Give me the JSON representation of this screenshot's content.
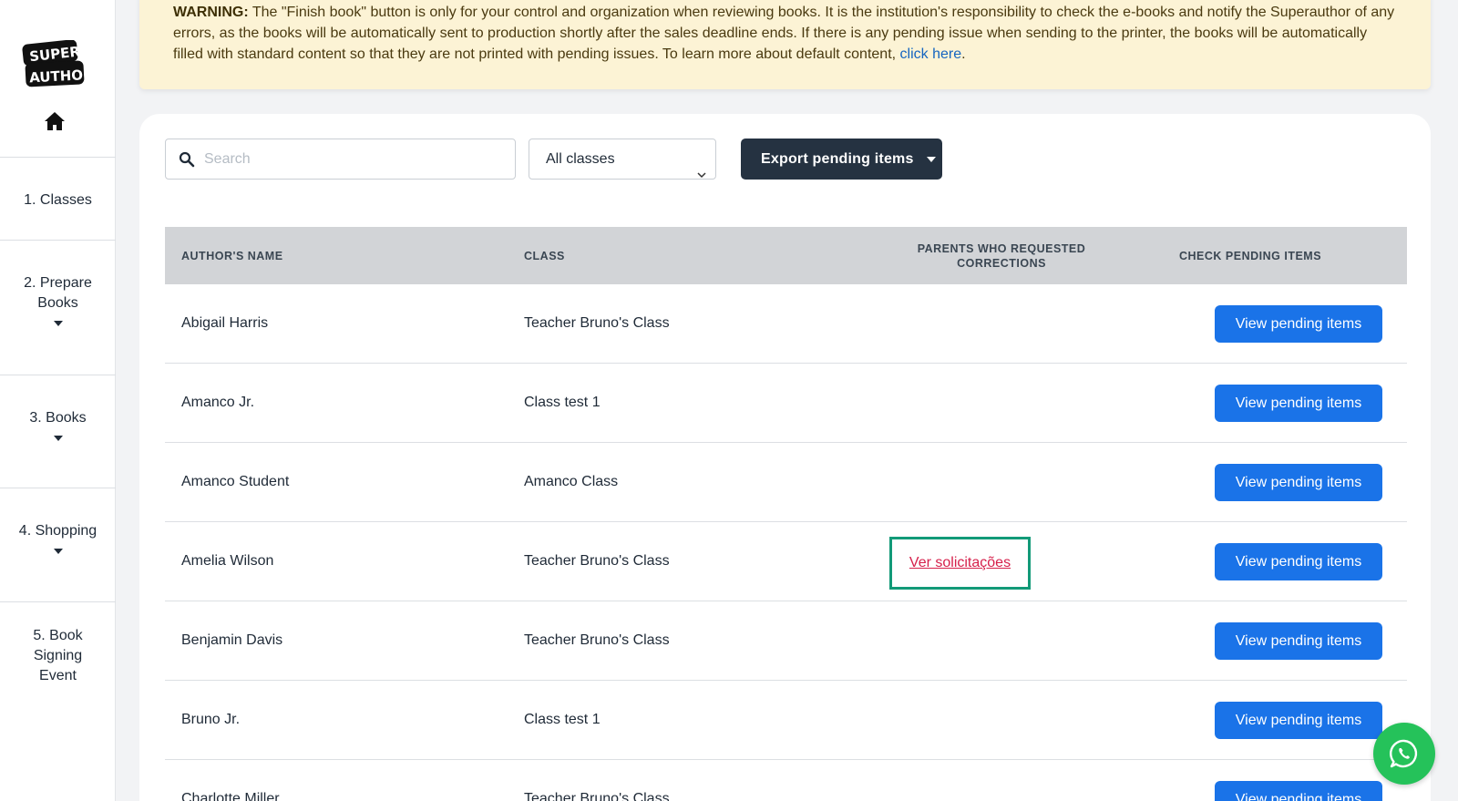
{
  "brand": {
    "logo_text_top": "SUPER",
    "logo_text_bottom": "AUTHOR"
  },
  "sidebar": {
    "items": [
      {
        "label": "1. Classes",
        "has_caret": false
      },
      {
        "label": "2. Prepare Books",
        "has_caret": true
      },
      {
        "label": "3. Books",
        "has_caret": true
      },
      {
        "label": "4. Shopping",
        "has_caret": true
      },
      {
        "label": "5. Book Signing Event",
        "has_caret": false
      }
    ]
  },
  "warning": {
    "prefix": "WARNING:",
    "text": " The \"Finish book\" button is only for your control and organization when reviewing books. It is the institution's responsibility to check the e-books and notify the Superauthor of any errors, as the books will be automatically sent to production shortly after the sales deadline ends. If there is any pending issue when sending to the printer, the books will be automatically filled with standard content so that they are not printed with pending issues. To learn more about default content, ",
    "link": "click here",
    "suffix": "."
  },
  "toolbar": {
    "search_placeholder": "Search",
    "search_value": "",
    "class_select": "All classes",
    "export_label": "Export pending items"
  },
  "table": {
    "headers": {
      "author": "AUTHOR'S NAME",
      "class": "CLASS",
      "parents": "PARENTS WHO REQUESTED CORRECTIONS",
      "check": "CHECK PENDING ITEMS"
    },
    "rows": [
      {
        "author": "Abigail Harris",
        "class": "Teacher Bruno's Class",
        "requests": "",
        "action": "View pending items"
      },
      {
        "author": "Amanco Jr.",
        "class": "Class test 1",
        "requests": "",
        "action": "View pending items"
      },
      {
        "author": "Amanco Student",
        "class": "Amanco Class",
        "requests": "",
        "action": "View pending items"
      },
      {
        "author": "Amelia Wilson",
        "class": "Teacher Bruno's Class",
        "requests": "Ver solicitações",
        "action": "View pending items"
      },
      {
        "author": "Benjamin Davis",
        "class": "Teacher Bruno's Class",
        "requests": "",
        "action": "View pending items"
      },
      {
        "author": "Bruno Jr.",
        "class": "Class test 1",
        "requests": "",
        "action": "View pending items"
      },
      {
        "author": "Charlotte Miller",
        "class": "Teacher Bruno's Class",
        "requests": "",
        "action": "View pending items"
      }
    ]
  },
  "colors": {
    "primary_button": "#1a73e8",
    "dark_button": "#253241",
    "warning_bg": "#fcf3d5",
    "request_link": "#d6204b",
    "highlight_border": "#129a78",
    "whatsapp": "#25c25a"
  },
  "icons": {
    "home": "home-icon",
    "search": "search-icon",
    "whatsapp": "whatsapp-icon"
  }
}
